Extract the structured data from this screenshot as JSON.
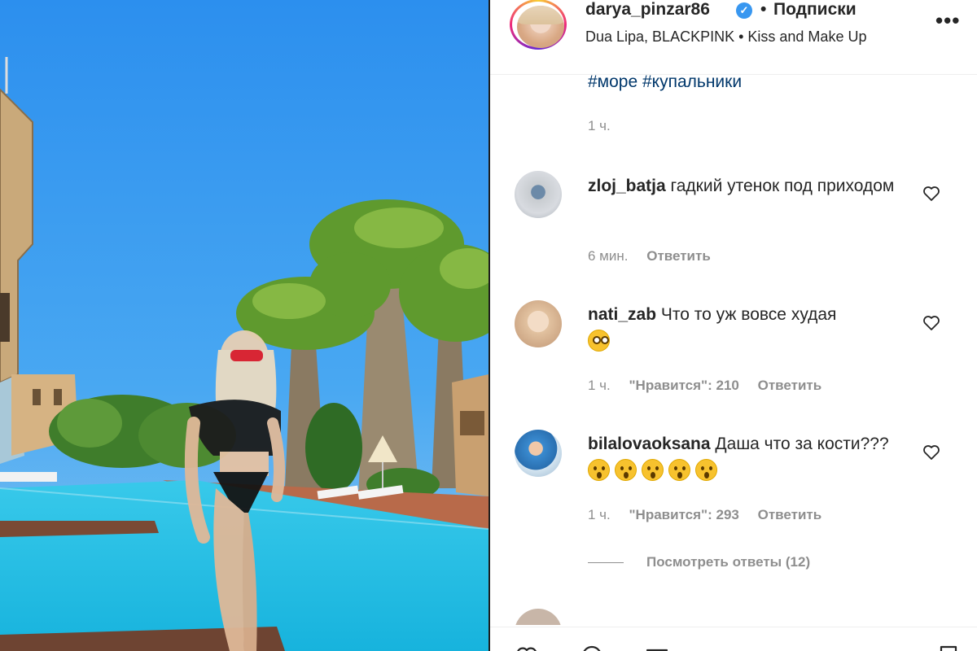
{
  "post": {
    "username": "darya_pinzar86",
    "follow_separator": "•",
    "follow_label": "Подписки",
    "music": "Dua Lipa, BLACKPINK • Kiss and Make Up",
    "more_icon": "more-horizontal-icon",
    "verified_icon": "verified-badge-icon"
  },
  "caption": {
    "tags": "#море #купальники",
    "time": "1 ч."
  },
  "comments": [
    {
      "username": "zloj_batja",
      "text": "гадкий утенок под приходом",
      "emojis": [],
      "time": "6 мин.",
      "likes_label": "",
      "reply_label": "Ответить"
    },
    {
      "username": "nati_zab",
      "text": "Что то уж вовсе худая",
      "emojis": [
        "flushed-face-emoji"
      ],
      "time": "1 ч.",
      "likes_label": "\"Нравится\": 210",
      "reply_label": "Ответить"
    },
    {
      "username": "bilalovaoksana",
      "text": "Даша что за кости???",
      "emojis": [
        "astonished-face-emoji",
        "astonished-face-emoji",
        "astonished-face-emoji",
        "astonished-face-emoji",
        "astonished-face-emoji"
      ],
      "time": "1 ч.",
      "likes_label": "\"Нравится\": 293",
      "reply_label": "Ответить"
    }
  ],
  "view_replies": "Посмотреть ответы (12)",
  "icons": {
    "heart": "heart-outline-icon",
    "like_action": "heart-icon",
    "comment_action": "comment-icon",
    "share_action": "share-icon",
    "save_action": "bookmark-icon"
  },
  "colors": {
    "link": "#00376b",
    "secondary_text": "#8e8e8e",
    "verified": "#3897f0",
    "sky": "#3a9bf0",
    "pool": "#2fc4e6"
  }
}
